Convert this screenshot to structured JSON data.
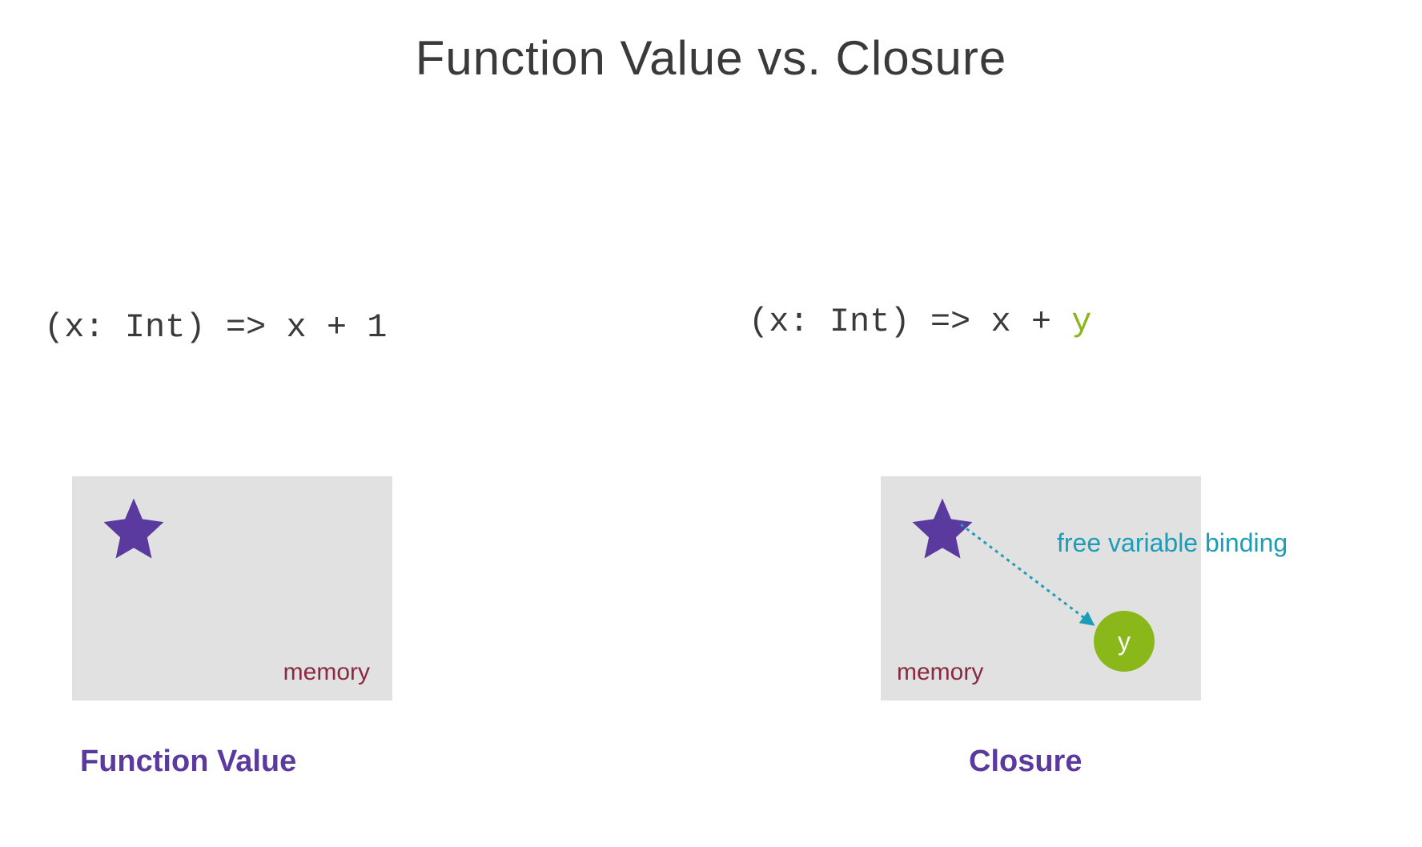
{
  "title": "Function Value vs. Closure",
  "left": {
    "code_prefix": "(x: Int) => x + 1",
    "memory_label": "memory",
    "caption": "Function Value"
  },
  "right": {
    "code_prefix": "(x: Int) => x + ",
    "code_free_var": "y",
    "memory_label": "memory",
    "caption": "Closure",
    "binding_label": "free variable binding",
    "binding_var": "y"
  },
  "colors": {
    "purple": "#5a3a9e",
    "green": "#8ab71a",
    "teal": "#1c9cb7",
    "maroon": "#8b2942",
    "grey_box": "#e1e1e1"
  }
}
